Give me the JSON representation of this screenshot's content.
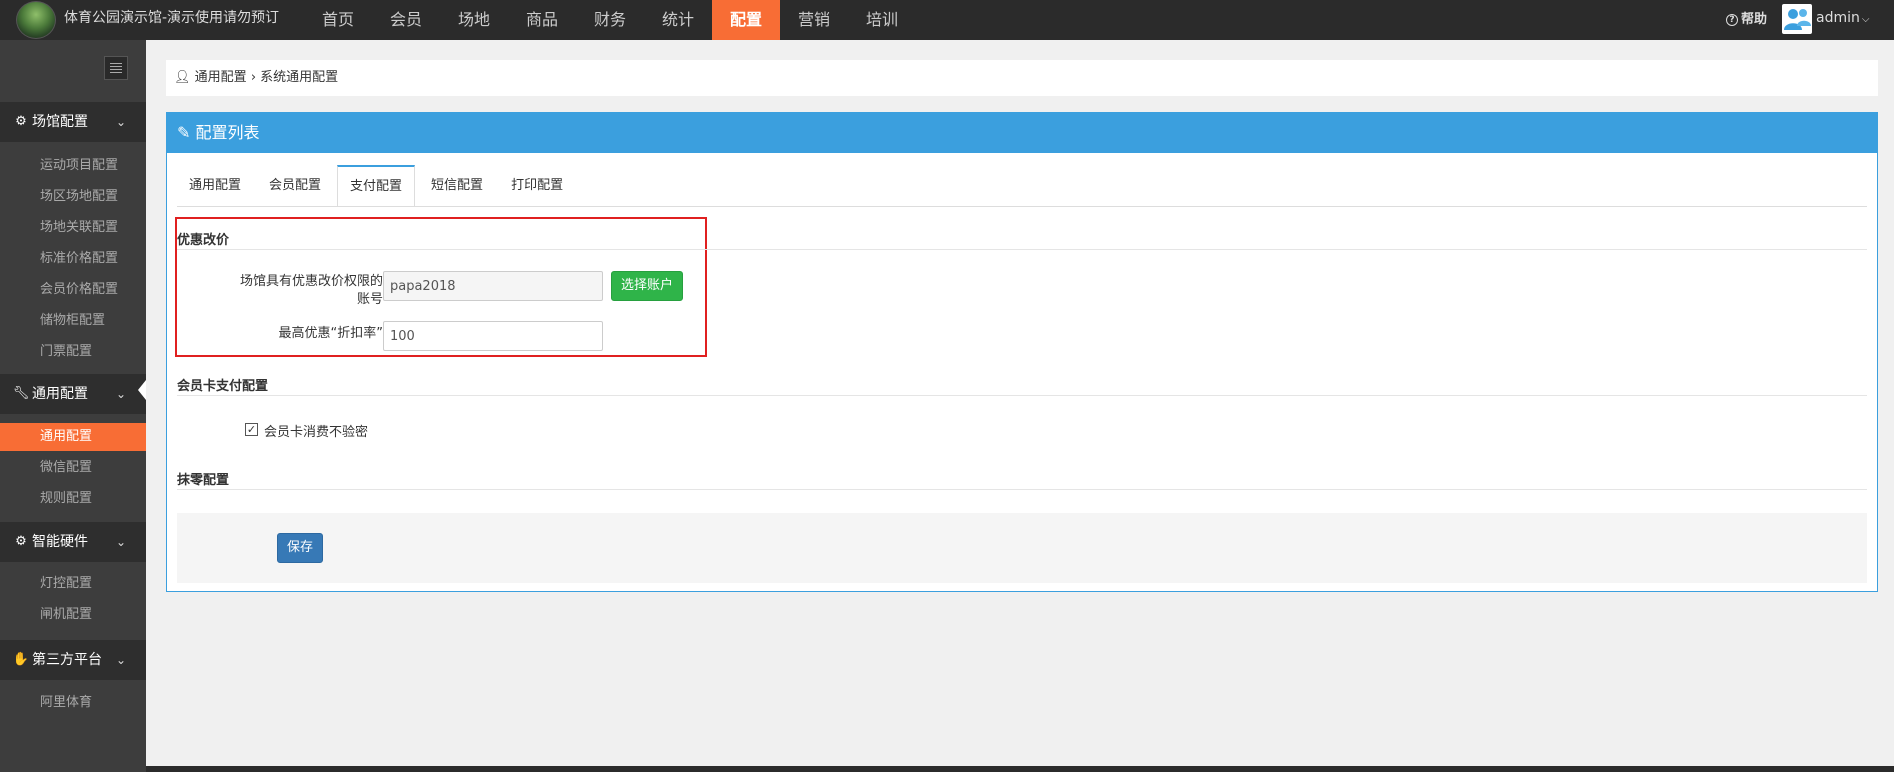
{
  "brand": {
    "title": "体育公园演示馆-演示使用请勿预订"
  },
  "nav": {
    "items": [
      "首页",
      "会员",
      "场地",
      "商品",
      "财务",
      "统计",
      "配置",
      "营销",
      "培训"
    ],
    "active_index": 6
  },
  "header_right": {
    "help_label": "帮助",
    "user_name": "admin"
  },
  "sidebar": {
    "groups": [
      {
        "label": "场馆配置",
        "icon": "cogs-icon",
        "items": [
          "运动项目配置",
          "场区场地配置",
          "场地关联配置",
          "标准价格配置",
          "会员价格配置",
          "储物柜配置",
          "门票配置"
        ]
      },
      {
        "label": "通用配置",
        "icon": "wrench-icon",
        "items": [
          "通用配置",
          "微信配置",
          "规则配置"
        ],
        "active_item": "通用配置"
      },
      {
        "label": "智能硬件",
        "icon": "gear-icon",
        "items": [
          "灯控配置",
          "闸机配置"
        ]
      },
      {
        "label": "第三方平台",
        "icon": "handshake-icon",
        "items": [
          "阿里体育"
        ]
      }
    ]
  },
  "breadcrumb": {
    "root": "通用配置",
    "separator": "›",
    "current": "系统通用配置"
  },
  "panel": {
    "title": "配置列表",
    "tabs": [
      "通用配置",
      "会员配置",
      "支付配置",
      "短信配置",
      "打印配置"
    ],
    "active_tab": "支付配置"
  },
  "discount_section": {
    "title": "优惠改价",
    "account_label_line1": "场馆具有优惠改价权限的",
    "account_label_line2": "账号",
    "account_value": "papa2018",
    "select_account_button": "选择账户",
    "max_discount_label": "最高优惠“折扣率”",
    "max_discount_value": "100"
  },
  "member_card_section": {
    "title": "会员卡支付配置",
    "no_password_label": "会员卡消费不验密",
    "no_password_checked": true
  },
  "rounding_section": {
    "title": "抹零配置"
  },
  "actions": {
    "save_label": "保存"
  },
  "colors": {
    "accent_orange": "#f86d35",
    "panel_blue": "#3b9fde",
    "green_button": "#2fb449",
    "save_blue": "#3779b6",
    "highlight_red": "#e02020"
  }
}
